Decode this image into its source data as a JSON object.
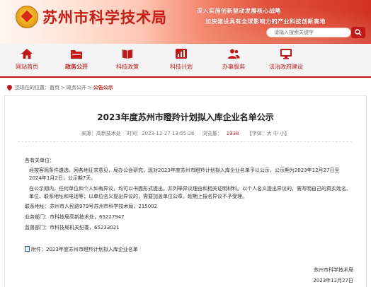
{
  "header": {
    "site_title": "苏州市科学技术局",
    "slogan_1": "深入实施创新驱动发展核心战略",
    "slogan_2": "加快建设具有全球影响力的产业科技创新高地",
    "search": {
      "placeholder": "请输入搜索关键字"
    }
  },
  "nav": {
    "items": [
      {
        "label": "网站首页",
        "icon": "home-icon"
      },
      {
        "label": "政务公开",
        "icon": "folder-icon"
      },
      {
        "label": "科技政策",
        "icon": "book-icon"
      },
      {
        "label": "科技计划",
        "icon": "chart-icon"
      },
      {
        "label": "办事服务",
        "icon": "people-icon"
      },
      {
        "label": "法治政府建设",
        "icon": "monitor-icon"
      }
    ],
    "active_index": 1
  },
  "breadcrumb": {
    "prefix": "您现在的位置：",
    "items": [
      "首页",
      "政务公开"
    ],
    "current": "公告公示",
    "separator": ">"
  },
  "article": {
    "title": "2023年度苏州市瞪羚计划拟入库企业名单公示",
    "meta": {
      "source": "来源：高新技术处",
      "time": "时间：2023-12-27 13:55:26",
      "views_label": "浏览量：",
      "views": "1938",
      "font_size": "【字体：大 中 小】"
    },
    "salutation": "各有关单位：",
    "paragraphs": [
      "经按客观条件遴选，网各地征求意见，局办公会研究，现对2023年度苏州市瞪羚计划拟入库企业名单予以公示，公示期为2023年12月27日至2024年1月2日，公示期7天。",
      "在公示期内，任何单位和个人如有异议，均可以书面形式提出，并列举异议理由和相关证明材料。以个人名义提出异议的，需写明自己的真实姓名、单位、联系地址和电话等；以单位名义提出异议的，需要加盖单位公章。超期上报名异议不予受理。"
    ],
    "contacts": [
      "联系地址：苏州市人民路979号苏州市科学技术局，215002",
      "业务部门：市科技局高新技术处，65227947",
      "监督部门：市科技局机关纪委，65233021"
    ],
    "attachment": "附件：2023年度苏州市瞪羚计划拟入库企业名单",
    "signature_org": "苏州市科学技术局",
    "signature_date": "2023年12月27日"
  },
  "colors": {
    "accent": "#c41818",
    "banner_dark": "#d23224",
    "banner_light": "#fff6f2"
  }
}
